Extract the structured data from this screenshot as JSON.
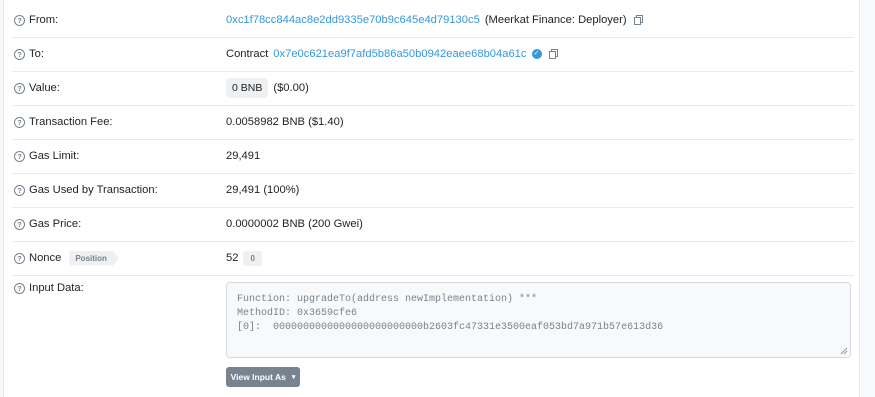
{
  "rows": {
    "from": {
      "label": "From:",
      "address": "0xc1f78cc844ac8e2dd9335e70b9c645e4d79130c5",
      "tag": "(Meerkat Finance: Deployer)"
    },
    "to": {
      "label": "To:",
      "prefix": "Contract",
      "address": "0x7e0c621ea9f7afd5b86a50b0942eaee68b04a61c"
    },
    "value": {
      "label": "Value:",
      "amount": "0 BNB",
      "usd": "($0.00)"
    },
    "fee": {
      "label": "Transaction Fee:",
      "value": "0.0058982 BNB ($1.40)"
    },
    "gas_limit": {
      "label": "Gas Limit:",
      "value": "29,491"
    },
    "gas_used": {
      "label": "Gas Used by Transaction:",
      "value": "29,491 (100%)"
    },
    "gas_price": {
      "label": "Gas Price:",
      "value": "0.0000002 BNB (200 Gwei)"
    },
    "nonce": {
      "label": "Nonce",
      "position_badge": "Position",
      "value": "52",
      "position": "0"
    },
    "input": {
      "label": "Input Data:",
      "line1": "Function: upgradeTo(address newImplementation) ***",
      "line2": "",
      "line3": "MethodID: 0x3659cfe6",
      "line4": "[0]:  0000000000000000000000000b2603fc47331e3500eaf053bd7a971b57e613d36",
      "button": "View Input As",
      "caret": "▾"
    }
  },
  "icons": {
    "help": "question-circle-icon",
    "copy": "copy-icon",
    "verified": "check-badge-icon"
  },
  "colors": {
    "link": "#3498db",
    "muted": "#77838f",
    "border": "#e7eaf3"
  }
}
